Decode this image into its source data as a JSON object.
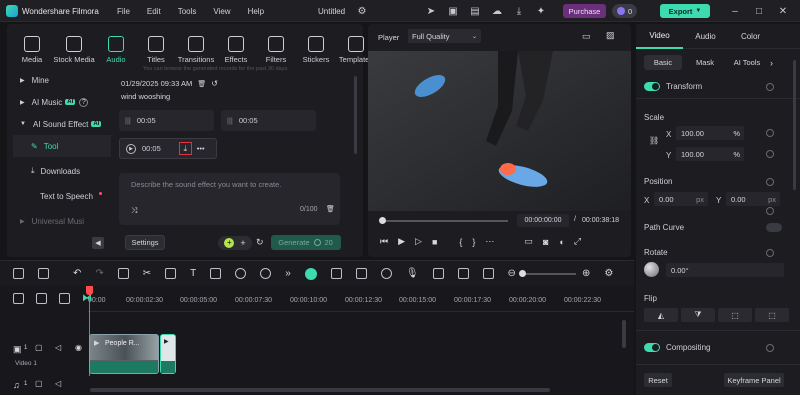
{
  "app": {
    "title": "Wondershare Filmora",
    "menu": [
      "File",
      "Edit",
      "Tools",
      "View",
      "Help"
    ],
    "project_title": "Untitled",
    "purchase_label": "Purchase",
    "credits": "0",
    "export_label": "Export"
  },
  "tools": [
    {
      "label": "Media",
      "icon": "media-icon"
    },
    {
      "label": "Stock Media",
      "icon": "stock-media-icon"
    },
    {
      "label": "Audio",
      "icon": "audio-icon"
    },
    {
      "label": "Titles",
      "icon": "titles-icon"
    },
    {
      "label": "Transitions",
      "icon": "transitions-icon"
    },
    {
      "label": "Effects",
      "icon": "effects-icon"
    },
    {
      "label": "Filters",
      "icon": "filters-icon"
    },
    {
      "label": "Stickers",
      "icon": "stickers-icon"
    },
    {
      "label": "Templates",
      "icon": "templates-icon"
    }
  ],
  "sidebar": {
    "mine": "Mine",
    "ai_music": "AI Music",
    "ai_badge": "AI",
    "ai_sound_effect": "AI Sound Effect",
    "tool": "Tool",
    "downloads": "Downloads",
    "text_to_speech": "Text to Speech",
    "universal": "Universal Musi"
  },
  "sfx": {
    "notice": "You can browse the generated records for the past 30 days.",
    "date": "01/29/2025 09:33 AM",
    "prompt": "wind wooshing",
    "durations": [
      "00:05",
      "00:05",
      "00:05"
    ],
    "placeholder": "Describe the sound effect you want to create.",
    "counter": "0/100",
    "settings_label": "Settings",
    "generate_label": "Generate",
    "generate_cost": "20"
  },
  "player": {
    "label": "Player",
    "quality": "Full Quality",
    "current_time": "00:00:00:00",
    "total_time": "00:00:38:18",
    "progress": 0.0
  },
  "inspector": {
    "tabs": [
      "Video",
      "Audio",
      "Color"
    ],
    "subtabs": [
      "Basic",
      "Mask",
      "AI Tools"
    ],
    "transform": "Transform",
    "scale": "Scale",
    "scale_x_label": "X",
    "scale_x": "100.00",
    "scale_y_label": "Y",
    "scale_y": "100.00",
    "percent": "%",
    "position": "Position",
    "pos_x_label": "X",
    "pos_x": "0.00",
    "pos_y_label": "Y",
    "pos_y": "0.00",
    "px": "px",
    "path_curve": "Path Curve",
    "rotate": "Rotate",
    "rotate_value": "0.00°",
    "flip": "Flip",
    "compositing": "Compositing",
    "reset_label": "Reset",
    "keyframe_label": "Keyframe Panel"
  },
  "timeline": {
    "ruler": [
      "00:00",
      "00:00:02:30",
      "00:00:05:00",
      "00:00:07:30",
      "00:00:10:00",
      "00:00:12:30",
      "00:00:15:00",
      "00:00:17:30",
      "00:00:20:00",
      "00:00:22:30"
    ],
    "track_number": "1",
    "track_name": "Video 1",
    "clip_name": "People R..."
  },
  "colors": {
    "accent": "#3ddbb0",
    "purchase": "#7a3a8a",
    "export": "#3ddbb0",
    "playhead": "#ff4d4d"
  }
}
